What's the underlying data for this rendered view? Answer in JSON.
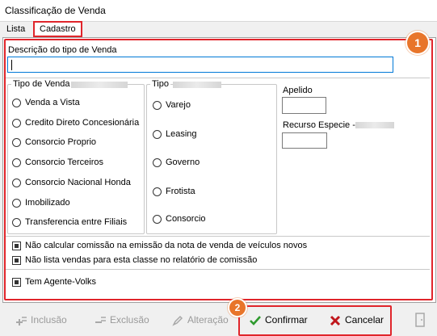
{
  "window": {
    "title": "Classificação de Venda"
  },
  "tabs": [
    {
      "label": "Lista",
      "active": false
    },
    {
      "label": "Cadastro",
      "active": true
    }
  ],
  "badges": {
    "first": "1",
    "second": "2"
  },
  "form": {
    "descricao_label": "Descrição do tipo de Venda",
    "descricao_value": "",
    "tipo_venda": {
      "label": "Tipo de Venda",
      "options": [
        "Venda a Vista",
        "Credito Direto Concesionária",
        "Consorcio Proprio",
        "Consorcio Terceiros",
        "Consorcio Nacional Honda",
        "Imobilizado",
        "Transferencia entre Filiais"
      ]
    },
    "tipo": {
      "label": "Tipo",
      "options": [
        "Varejo",
        "Leasing",
        "Governo",
        "Frotista",
        "Consorcio"
      ]
    },
    "apelido_label": "Apelido",
    "apelido_value": "",
    "recurso_label": "Recurso Especie -",
    "recurso_value": "",
    "checkboxes": [
      {
        "label": "Não calcular comissão na emissão da nota de venda de veículos novos",
        "checked": true
      },
      {
        "label": "Não lista vendas para esta classe no relatório de comissão",
        "checked": true
      }
    ],
    "agente": {
      "label": "Tem Agente-Volks",
      "checked": true
    }
  },
  "toolbar": {
    "inclusao": "Inclusão",
    "exclusao": "Exclusão",
    "alteracao": "Alteração",
    "confirmar": "Confirmar",
    "cancelar": "Cancelar"
  },
  "colors": {
    "highlight": "#e0252b",
    "badge": "#e8752a",
    "focus": "#0078d7",
    "confirm": "#2e9a2e",
    "cancel": "#c0161c"
  },
  "icons": [
    "add-icon",
    "delete-icon",
    "edit-icon",
    "check-icon",
    "x-icon",
    "exit-door-icon"
  ]
}
